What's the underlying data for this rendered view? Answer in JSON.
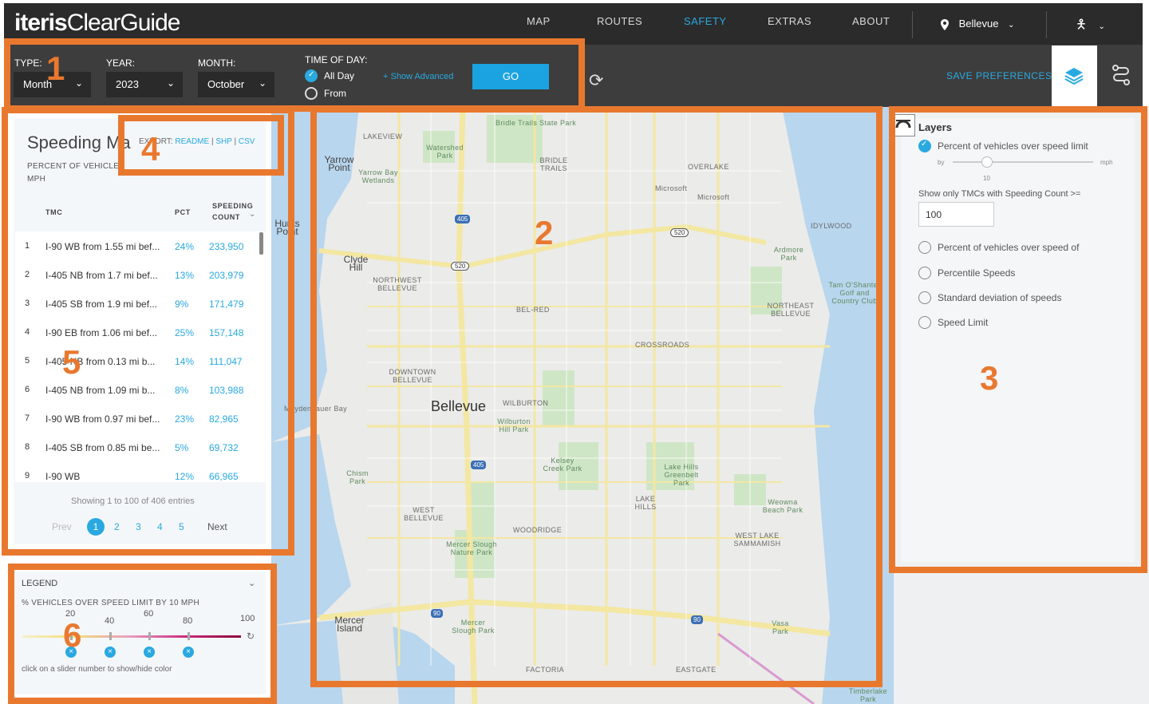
{
  "nav": {
    "logo_brand": "iteris",
    "logo_product": "ClearGuide",
    "items": [
      "MAP",
      "ROUTES",
      "SAFETY",
      "EXTRAS",
      "ABOUT"
    ],
    "active": "SAFETY",
    "location": "Bellevue"
  },
  "toolbar": {
    "type_label": "TYPE:",
    "type_value": "Month",
    "year_label": "YEAR:",
    "year_value": "2023",
    "month_label": "MONTH:",
    "month_value": "October",
    "tod_label": "TIME OF DAY:",
    "all_day": "All Day",
    "from": "From",
    "show_advanced": "+ Show Advanced",
    "go": "GO",
    "save_preferences": "SAVE PREFERENCES"
  },
  "panel": {
    "title": "Speeding Ma",
    "subtitle_start": "PERCENT OF VEHICLES",
    "subtitle_end": "MPH",
    "export_label": "EXPORT:",
    "export_readme": "README",
    "export_shp": "SHP",
    "export_csv": "CSV",
    "col_tmc": "TMC",
    "col_pct": "PCT",
    "col_count_1": "SPEEDING",
    "col_count_2": "COUNT",
    "rows": [
      {
        "idx": "1",
        "tmc": "I-90 WB from 1.55 mi bef...",
        "pct": "24%",
        "count": "233,950"
      },
      {
        "idx": "2",
        "tmc": "I-405 NB from 1.7 mi bef...",
        "pct": "13%",
        "count": "203,979"
      },
      {
        "idx": "3",
        "tmc": "I-405 SB from 1.9 mi bef...",
        "pct": "9%",
        "count": "171,479"
      },
      {
        "idx": "4",
        "tmc": "I-90 EB from 1.06 mi bef...",
        "pct": "25%",
        "count": "157,148"
      },
      {
        "idx": "5",
        "tmc": "I-405 NB from 0.13 mi b...",
        "pct": "14%",
        "count": "111,047"
      },
      {
        "idx": "6",
        "tmc": "I-405 NB from 1.09 mi b...",
        "pct": "8%",
        "count": "103,988"
      },
      {
        "idx": "7",
        "tmc": "I-90 WB from 0.97 mi bef...",
        "pct": "23%",
        "count": "82,965"
      },
      {
        "idx": "8",
        "tmc": "I-405 SB from 0.85 mi be...",
        "pct": "5%",
        "count": "69,732"
      },
      {
        "idx": "9",
        "tmc": "I-90 WB",
        "pct": "12%",
        "count": "66,965"
      }
    ],
    "showing": "Showing 1 to 100 of 406 entries",
    "prev": "Prev",
    "pages": [
      "1",
      "2",
      "3",
      "4",
      "5"
    ],
    "next": "Next"
  },
  "legend": {
    "title": "LEGEND",
    "subtitle": "% VEHICLES OVER SPEED LIMIT BY 10 MPH",
    "stops": [
      "20",
      "40",
      "60",
      "80",
      "100"
    ],
    "hint": "click on a slider number to show/hide color"
  },
  "layers": {
    "title": "Layers",
    "opt1": "Percent of vehicles over speed limit",
    "by": "by",
    "mph": "mph",
    "by_value": "10",
    "count_label": "Show only TMCs with Speeding Count >=",
    "count_value": "100",
    "opt2": "Percent of vehicles over speed of",
    "opt3": "Percentile Speeds",
    "opt4": "Standard deviation of speeds",
    "opt5": "Speed Limit"
  },
  "map": {
    "labels": {
      "bridle_state": "Bridle Trails State Park",
      "lakeview": "LAKEVIEW",
      "yarrow_point": "Yarrow Point",
      "yarrow_bay": "Yarrow Bay Wetlands",
      "watershed": "Watershed Park",
      "bridle": "BRIDLE TRAILS",
      "overlake": "OVERLAKE",
      "microsoft1": "Microsoft",
      "microsoft2": "Microsoft",
      "idylwood": "IDYLWOOD",
      "ardmore": "Ardmore Park",
      "tam_o_shanter": "Tam O'Shanter Golf and Country Club",
      "clyde_hill": "Clyde Hill",
      "nw_bellevue": "NORTHWEST BELLEVUE",
      "bel_red": "BEL-RED",
      "ne_bellevue": "NORTHEAST BELLEVUE",
      "crossroads": "CROSSROADS",
      "downtown": "DOWNTOWN BELLEVUE",
      "wilburton": "WILBURTON",
      "bellevue": "Bellevue",
      "wilburton_park": "Wilburton Hill Park",
      "kelsey": "Kelsey Creek Park",
      "lake_hills_gb": "Lake Hills Greenbelt Park",
      "chism": "Chism Park",
      "west_bellevue": "WEST BELLEVUE",
      "lake_hills": "LAKE HILLS",
      "weowna": "Weowna Beach Park",
      "woodridge": "WOODRIDGE",
      "west_lake_sammamish": "WEST LAKE SAMMAMISH",
      "mercer_slough": "Mercer Slough Nature Park",
      "mercer_island": "Mercer Island",
      "mercer_slough2": "Mercer Slough Park",
      "vasa": "Vasa Park",
      "factoria": "FACTORIA",
      "eastgate": "EASTGATE",
      "timberlake": "Timberlake Park",
      "hunts_point": "Hunts Point",
      "meydenbauer": "Meydenbauer Bay"
    },
    "shields": {
      "i405a": "405",
      "sr520a": "520",
      "sr520b": "520",
      "i405b": "405",
      "i90a": "90",
      "i90b": "90"
    }
  },
  "annotations": [
    "1",
    "2",
    "3",
    "4",
    "5",
    "6"
  ],
  "colors": {
    "accent": "#29a9e0",
    "annotation": "#e9782f",
    "nav_bg": "#2b2b2b",
    "toolbar_bg": "#3d3d3d"
  }
}
